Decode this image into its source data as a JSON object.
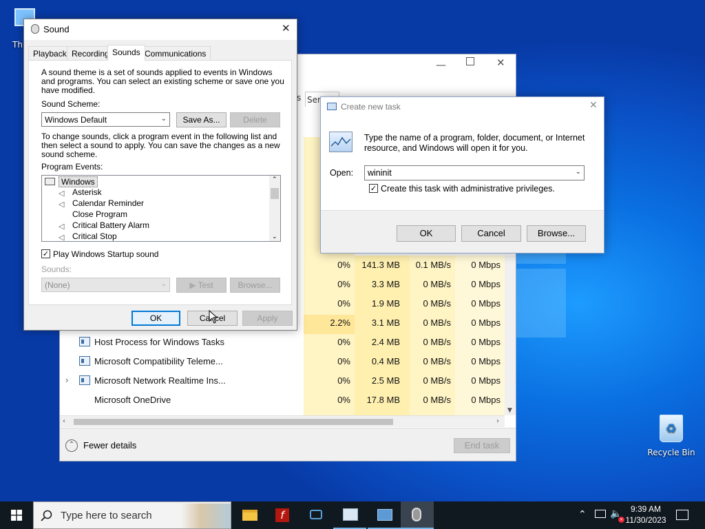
{
  "desktop": {
    "icon_this_pc": "Th",
    "icon_recycle_bin": "Recycle Bin"
  },
  "task_manager": {
    "tab_partial": "s",
    "tab_services_partial": "Serv",
    "rows": [
      {
        "name": "",
        "cpu": "0%",
        "mem": "141.3 MB",
        "disk": "0.1 MB/s",
        "net": "0 Mbps"
      },
      {
        "name": "",
        "cpu": "0%",
        "mem": "3.3 MB",
        "disk": "0 MB/s",
        "net": "0 Mbps"
      },
      {
        "name": "",
        "cpu": "0%",
        "mem": "1.9 MB",
        "disk": "0 MB/s",
        "net": "0 Mbps"
      },
      {
        "name": "",
        "cpu": "2.2%",
        "mem": "3.1 MB",
        "disk": "0 MB/s",
        "net": "0 Mbps"
      },
      {
        "name": "Host Process for Windows Tasks",
        "cpu": "0%",
        "mem": "2.4 MB",
        "disk": "0 MB/s",
        "net": "0 Mbps"
      },
      {
        "name": "Microsoft Compatibility Teleme...",
        "cpu": "0%",
        "mem": "0.4 MB",
        "disk": "0 MB/s",
        "net": "0 Mbps"
      },
      {
        "name": "Microsoft Network Realtime Ins...",
        "cpu": "0%",
        "mem": "2.5 MB",
        "disk": "0 MB/s",
        "net": "0 Mbps"
      },
      {
        "name": "Microsoft OneDrive",
        "cpu": "0%",
        "mem": "17.8 MB",
        "disk": "0 MB/s",
        "net": "0 Mbps"
      }
    ],
    "fewer_details": "Fewer details",
    "end_task": "End task"
  },
  "sound_dialog": {
    "title": "Sound",
    "tabs": [
      "Playback",
      "Recording",
      "Sounds",
      "Communications"
    ],
    "intro_lines": [
      "A sound theme is a set of sounds applied to events in Windows",
      "and programs.  You can select an existing scheme or save one you",
      "have modified."
    ],
    "scheme_label": "Sound Scheme:",
    "scheme_value": "Windows Default",
    "save_as": "Save As...",
    "delete": "Delete",
    "change_lines": [
      "To change sounds, click a program event in the following list and",
      "then select a sound to apply.  You can save the changes as a new",
      "sound scheme."
    ],
    "events_label": "Program Events:",
    "events": [
      "Windows",
      "Asterisk",
      "Calendar Reminder",
      "Close Program",
      "Critical Battery Alarm",
      "Critical Stop"
    ],
    "startup_label": "Play Windows Startup sound",
    "sounds_label": "Sounds:",
    "sounds_value": "(None)",
    "test": "Test",
    "browse": "Browse...",
    "ok": "OK",
    "cancel": "Cancel",
    "apply": "Apply"
  },
  "create_task": {
    "title": "Create new task",
    "description_lines": [
      "Type the name of a program, folder, document, or Internet",
      "resource, and Windows will open it for you."
    ],
    "open_label": "Open:",
    "open_value": "wininit",
    "admin_label": "Create this task with administrative privileges.",
    "ok": "OK",
    "cancel": "Cancel",
    "browse": "Browse..."
  },
  "taskbar": {
    "search_placeholder": "Type here to search",
    "time": "9:39 AM",
    "date": "11/30/2023"
  }
}
